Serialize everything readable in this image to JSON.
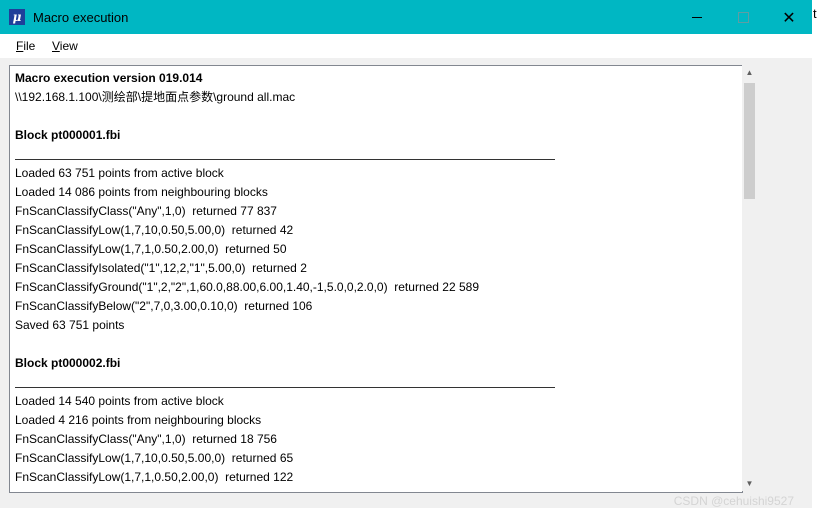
{
  "window": {
    "title": "Macro execution",
    "app_icon_glyph": "μ",
    "controls": {
      "minimize_icon": "minimize-icon",
      "maximize_icon": "maximize-icon",
      "close_glyph": "✕"
    },
    "edge_char": "t"
  },
  "menu": {
    "file": {
      "accel": "F",
      "rest": "ile"
    },
    "view": {
      "accel": "V",
      "rest": "iew"
    }
  },
  "log": {
    "header": "Macro execution version 019.014",
    "path": "\\\\192.168.1.100\\测绘部\\提地面点参数\\ground all.mac",
    "blocks": [
      {
        "title": "Block pt000001.fbi",
        "lines": [
          "Loaded 63 751 points from active block",
          "Loaded 14 086 points from neighbouring blocks",
          "FnScanClassifyClass(\"Any\",1,0)  returned 77 837",
          "FnScanClassifyLow(1,7,10,0.50,5.00,0)  returned 42",
          "FnScanClassifyLow(1,7,1,0.50,2.00,0)  returned 50",
          "FnScanClassifyIsolated(\"1\",12,2,\"1\",5.00,0)  returned 2",
          "FnScanClassifyGround(\"1\",2,\"2\",1,60.0,88.00,6.00,1.40,-1,5.0,0,2.0,0)  returned 22 589",
          "FnScanClassifyBelow(\"2\",7,0,3.00,0.10,0)  returned 106",
          "Saved 63 751 points"
        ]
      },
      {
        "title": "Block pt000002.fbi",
        "lines": [
          "Loaded 14 540 points from active block",
          "Loaded 4 216 points from neighbouring blocks",
          "FnScanClassifyClass(\"Any\",1,0)  returned 18 756",
          "FnScanClassifyLow(1,7,10,0.50,5.00,0)  returned 65",
          "FnScanClassifyLow(1,7,1,0.50,2.00,0)  returned 122"
        ]
      }
    ]
  },
  "scrollbar": {
    "up_glyph": "▲",
    "down_glyph": "▼"
  },
  "watermark": "CSDN @cehuishi9527",
  "colors": {
    "titlebar": "#00b7c3",
    "text": "#000000",
    "pane_bg": "#ffffff"
  }
}
